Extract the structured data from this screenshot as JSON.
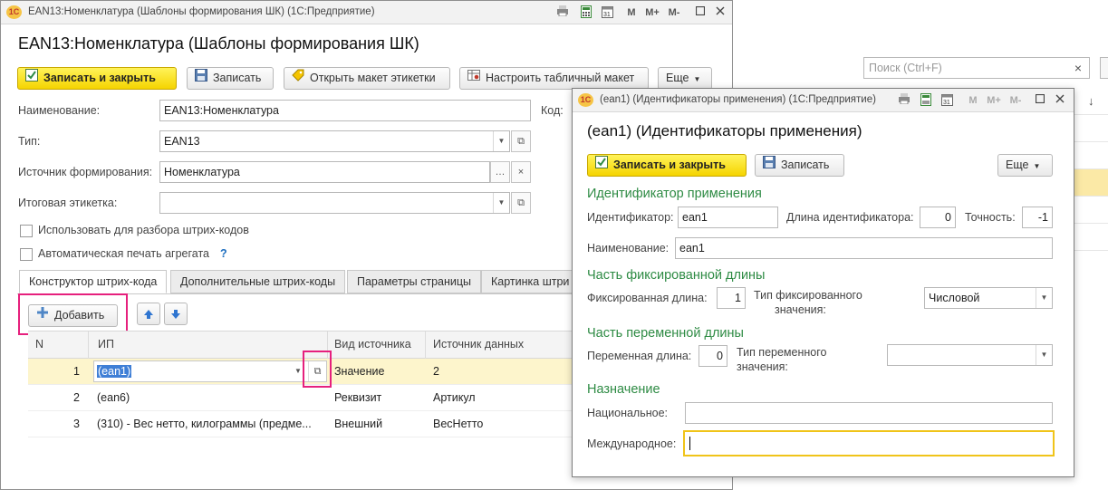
{
  "main": {
    "title_bar": "EAN13:Номенклатура (Шаблоны формирования ШК)  (1С:Предприятие)",
    "title_icons": {
      "m": "M",
      "m_plus": "M+",
      "m_minus": "M-"
    },
    "heading": "EAN13:Номенклатура (Шаблоны формирования ШК)",
    "toolbar": {
      "save_close": "Записать и закрыть",
      "save": "Записать",
      "open_label": "Открыть макет этикетки",
      "setup_table": "Настроить табличный макет",
      "more": "Еще"
    },
    "fields": {
      "name_label": "Наименование:",
      "name_value": "EAN13:Номенклатура",
      "code_label": "Код:",
      "type_label": "Тип:",
      "type_value": "EAN13",
      "source_label": "Источник формирования:",
      "source_value": "Номенклатура",
      "total_label": "Итоговая этикетка:",
      "total_value": ""
    },
    "checkboxes": {
      "use_parse": "Использовать для разбора штрих-кодов",
      "auto_print": "Автоматическая печать агрегата",
      "help": "?"
    },
    "tabs": [
      "Конструктор штрих-кода",
      "Дополнительные штрих-коды",
      "Параметры страницы",
      "Картинка штри"
    ],
    "table_toolbar": {
      "add": "Добавить"
    },
    "table": {
      "headers": [
        "N",
        "ИП",
        "Вид источника",
        "Источник данных"
      ],
      "rows": [
        {
          "n": "1",
          "ip": "(ean1)",
          "kind": "Значение",
          "source": "2"
        },
        {
          "n": "2",
          "ip": "(ean6)",
          "kind": "Реквизит",
          "source": "Артикул"
        },
        {
          "n": "3",
          "ip": "(310) - Вес нетто, килограммы (предме...",
          "kind": "Внешний",
          "source": "ВесНетто"
        }
      ]
    }
  },
  "background": {
    "search_placeholder": "Поиск (Ctrl+F)",
    "clear": "×"
  },
  "dialog": {
    "title_bar": "(ean1) (Идентификаторы применения)  (1С:Предприятие)",
    "heading": "(ean1) (Идентификаторы применения)",
    "toolbar": {
      "save_close": "Записать и закрыть",
      "save": "Записать",
      "more": "Еще"
    },
    "section_id": "Идентификатор применения",
    "id_label": "Идентификатор:",
    "id_value": "ean1",
    "id_len_label": "Длина идентификатора:",
    "id_len_value": "0",
    "precision_label": "Точность:",
    "precision_value": "-1",
    "name_label": "Наименование:",
    "name_value": "ean1",
    "section_fixed": "Часть фиксированной длины",
    "fixed_len_label": "Фиксированная длина:",
    "fixed_len_value": "1",
    "fixed_type_label": [
      "Тип фиксированного",
      "значения:"
    ],
    "fixed_type_value": "Числовой",
    "section_var": "Часть переменной длины",
    "var_len_label": "Переменная длина:",
    "var_len_value": "0",
    "var_type_label": [
      "Тип переменного",
      "значения:"
    ],
    "var_type_value": "",
    "section_purpose": "Назначение",
    "national_label": "Национальное:",
    "national_value": "",
    "international_label": "Международное:",
    "international_value": ""
  },
  "colors": {
    "accent_green": "#2e8b44",
    "highlight": "#e6207d",
    "primary_button": "#f5d400",
    "selected_row": "#fdf5cc"
  }
}
